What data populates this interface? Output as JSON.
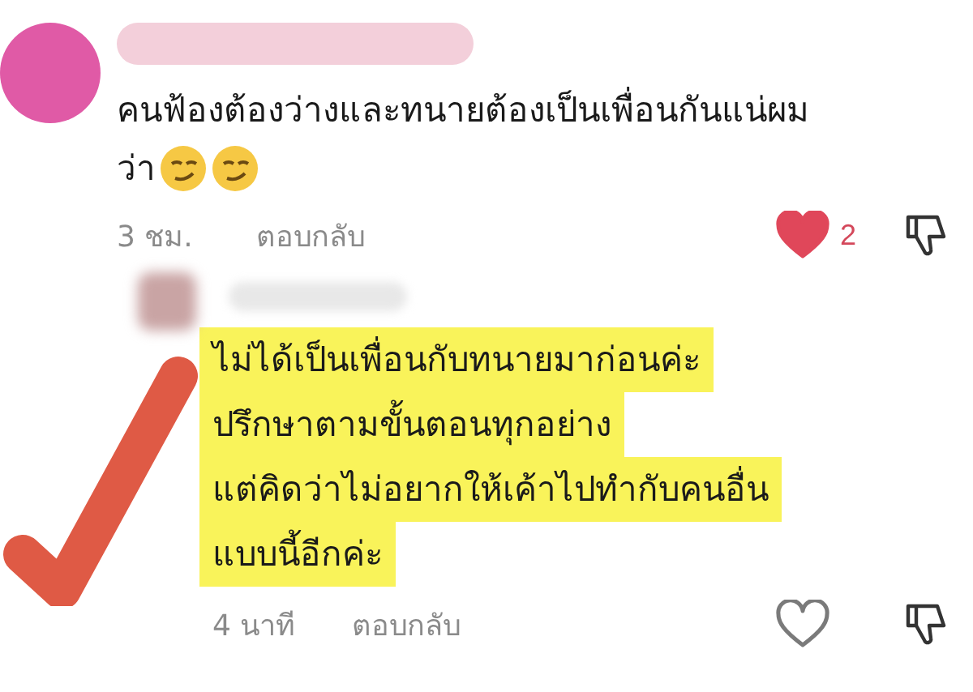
{
  "comments": [
    {
      "avatar": {
        "kind": "plain",
        "color": "#e05aa6"
      },
      "lines": [
        "คนฟ้องต้องว่างและทนายต้องเป็นเพื่อนกันแน่ผม",
        "ว่า"
      ],
      "emoji": [
        {
          "kind": "smirk"
        },
        {
          "kind": "smirk"
        }
      ],
      "highlighted": false,
      "time": "3 ชม.",
      "reply": "ตอบกลับ",
      "liked": true,
      "like_count": "2"
    },
    {
      "avatar": {
        "kind": "blurred"
      },
      "lines": [
        "ไม่ได้เป็นเพื่อนกับทนายมาก่อนค่ะ",
        "ปรึกษาตามขั้นตอนทุกอย่าง",
        "แต่คิดว่าไม่อยากให้เค้าไปทำกับคนอื่น",
        "แบบนี้อีกค่ะ"
      ],
      "highlighted": true,
      "time": "4 นาที",
      "reply": "ตอบกลับ",
      "liked": false
    }
  ],
  "annotation": {
    "kind": "checkmark"
  }
}
